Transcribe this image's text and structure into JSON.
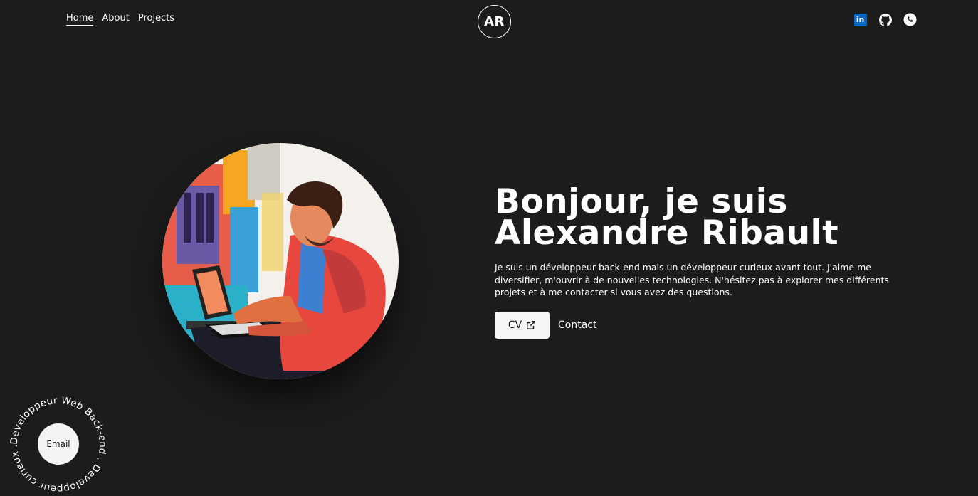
{
  "nav": {
    "items": [
      {
        "label": "Home",
        "active": true
      },
      {
        "label": "About",
        "active": false
      },
      {
        "label": "Projects",
        "active": false
      }
    ]
  },
  "logo": {
    "initials": "AR"
  },
  "social": {
    "icons": [
      "linkedin-icon",
      "github-icon",
      "phone-icon"
    ],
    "linkedin_text": "in"
  },
  "hero": {
    "headline_line1": "Bonjour, je suis",
    "headline_line2": "Alexandre Ribault",
    "description": "Je suis un développeur back-end mais un développeur curieux avant tout. J'aime me diversifier, m'ouvrir à de nouvelles technologies. N'hésitez pas à explorer mes différents projets et à me contacter si vous avez des questions.",
    "cv_label": "CV",
    "contact_label": "Contact"
  },
  "badge": {
    "circular_text": "Developpeur Web Back-end . Developpeur curieux . ",
    "email_label": "Email"
  },
  "colors": {
    "background": "#1c1c1c",
    "text": "#ffffff",
    "button_bg": "#f5f5f5",
    "linkedin": "#0a66c2"
  }
}
